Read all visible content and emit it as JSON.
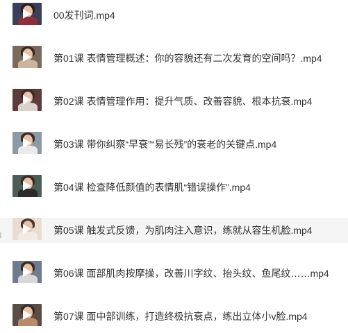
{
  "files": [
    {
      "name": "00发刊词.mp4",
      "icon": "video-thumbnail-icon"
    },
    {
      "name": "第01课 表情管理概述：你的容貌还有二次发育的空间吗？.mp4",
      "icon": "video-thumbnail-icon"
    },
    {
      "name": "第02课 表情管理作用：提升气质、改善容貌、根本抗衰.mp4",
      "icon": "video-thumbnail-icon"
    },
    {
      "name": "第03课 带你纠察“早衰”“易长残”的衰老的关键点.mp4",
      "icon": "video-thumbnail-icon"
    },
    {
      "name": "第04课 检查降低颜值的表情肌“错误操作”.mp4",
      "icon": "video-thumbnail-icon"
    },
    {
      "name": "第05课 触发式反馈，为肌肉注入意识，练就从容生机脸.mp4",
      "icon": "video-thumbnail-icon",
      "selected": true
    },
    {
      "name": "第06课 面部肌肉按摩操，改善川字纹、抬头纹、鱼尾纹……mp4",
      "icon": "video-thumbnail-icon"
    },
    {
      "name": "第07课 面中部训练，打造终极抗衰点，练出立体小v脸.mp4",
      "icon": "video-thumbnail-icon"
    }
  ],
  "colors": {
    "text": "#333333",
    "selected_bg": "#f5f5f5"
  }
}
